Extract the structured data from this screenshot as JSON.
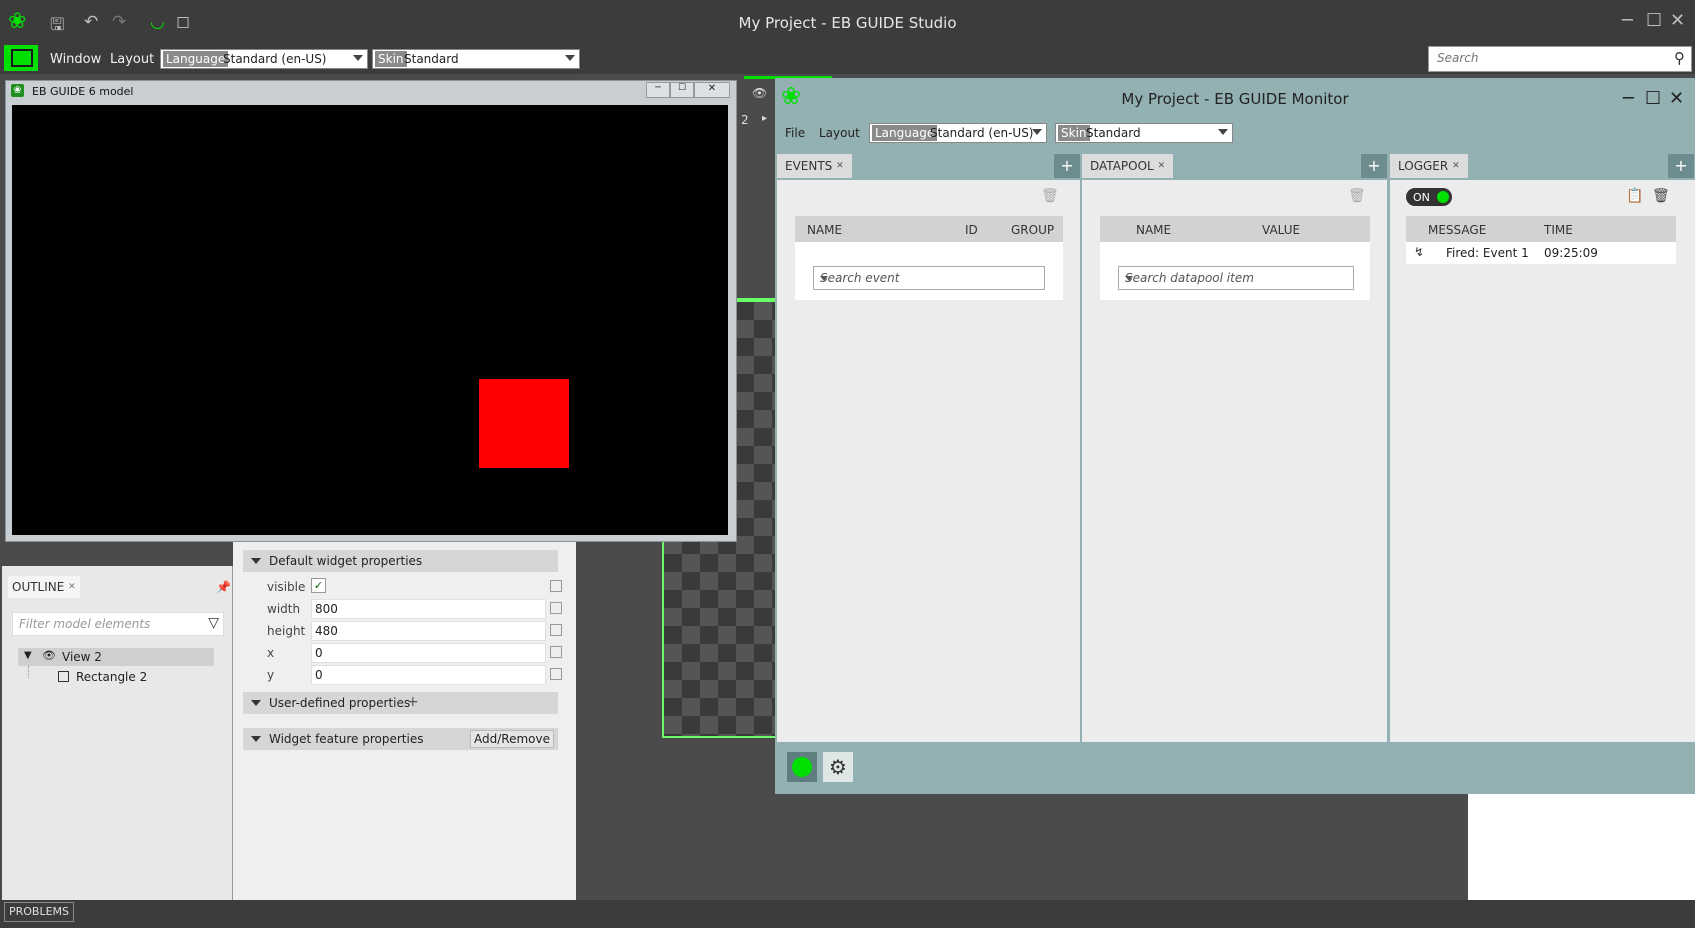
{
  "studio": {
    "title": "My Project - EB GUIDE Studio",
    "menu": {
      "window": "Window",
      "layout": "Layout"
    },
    "language": {
      "tag": "Language",
      "value": "Standard (en-US)"
    },
    "skin": {
      "tag": "Skin",
      "value": "Standard"
    },
    "search_placeholder": "Search",
    "accent_color": "#00e000"
  },
  "model_window": {
    "title": "EB GUIDE 6 model",
    "rect_color": "#ff0000"
  },
  "outline": {
    "tab": "OUTLINE",
    "filter_placeholder": "Filter model elements",
    "tree": [
      {
        "label": "View 2"
      },
      {
        "label": "Rectangle 2"
      }
    ]
  },
  "properties": {
    "default_section": "Default widget properties",
    "rows": [
      {
        "label": "visible",
        "value": ""
      },
      {
        "label": "width",
        "value": "800"
      },
      {
        "label": "height",
        "value": "480"
      },
      {
        "label": "x",
        "value": "0"
      },
      {
        "label": "y",
        "value": "0"
      }
    ],
    "user_defined_section": "User-defined properties",
    "feature_section": "Widget feature properties",
    "add_remove": "Add/Remove"
  },
  "canvas": {
    "zoom_label": "2"
  },
  "monitor": {
    "title": "My Project - EB GUIDE Monitor",
    "menu": {
      "file": "File",
      "layout": "Layout"
    },
    "language": {
      "tag": "Language",
      "value": "Standard (en-US)"
    },
    "skin": {
      "tag": "Skin",
      "value": "Standard"
    },
    "events": {
      "tab": "EVENTS",
      "columns": [
        "NAME",
        "ID",
        "GROUP"
      ],
      "search_placeholder": "Search event"
    },
    "datapool": {
      "tab": "DATAPOOL",
      "columns": [
        "NAME",
        "VALUE"
      ],
      "search_placeholder": "Search datapool item"
    },
    "logger": {
      "tab": "LOGGER",
      "toggle": "ON",
      "columns": [
        "MESSAGE",
        "TIME"
      ],
      "rows": [
        {
          "message": "Fired: Event 1",
          "time": "09:25:09"
        }
      ]
    },
    "plus": "+"
  },
  "statusbar": {
    "problems": "PROBLEMS"
  }
}
